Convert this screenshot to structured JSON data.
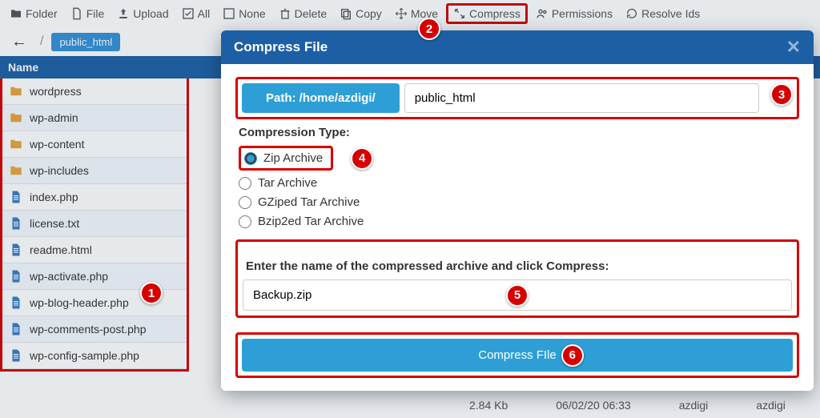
{
  "toolbar": {
    "folder": "Folder",
    "file": "File",
    "upload": "Upload",
    "all": "All",
    "none": "None",
    "delete": "Delete",
    "copy": "Copy",
    "move": "Move",
    "compress": "Compress",
    "permissions": "Permissions",
    "resolve": "Resolve Ids"
  },
  "breadcrumb": {
    "current": "public_html"
  },
  "table": {
    "name_header": "Name",
    "sample_size": "2.84 Kb",
    "sample_date": "06/02/20 06:33",
    "sample_owner": "azdigi",
    "sample_group": "azdigi"
  },
  "files": [
    {
      "name": "wordpress",
      "type": "folder"
    },
    {
      "name": "wp-admin",
      "type": "folder"
    },
    {
      "name": "wp-content",
      "type": "folder"
    },
    {
      "name": "wp-includes",
      "type": "folder"
    },
    {
      "name": "index.php",
      "type": "file"
    },
    {
      "name": "license.txt",
      "type": "file"
    },
    {
      "name": "readme.html",
      "type": "file"
    },
    {
      "name": "wp-activate.php",
      "type": "file"
    },
    {
      "name": "wp-blog-header.php",
      "type": "file"
    },
    {
      "name": "wp-comments-post.php",
      "type": "file"
    },
    {
      "name": "wp-config-sample.php",
      "type": "file"
    }
  ],
  "modal": {
    "title": "Compress File",
    "path_label": "Path: /home/azdigi/",
    "path_value": "public_html",
    "ctype_label": "Compression Type:",
    "ctype_zip": "Zip Archive",
    "ctype_tar": "Tar Archive",
    "ctype_gz": "GZiped Tar Archive",
    "ctype_bz": "Bzip2ed Tar Archive",
    "enter_label": "Enter the name of the compressed archive and click Compress:",
    "archive_name": "Backup.zip",
    "button": "Compress FIle"
  },
  "callouts": {
    "c1": "1",
    "c2": "2",
    "c3": "3",
    "c4": "4",
    "c5": "5",
    "c6": "6"
  }
}
